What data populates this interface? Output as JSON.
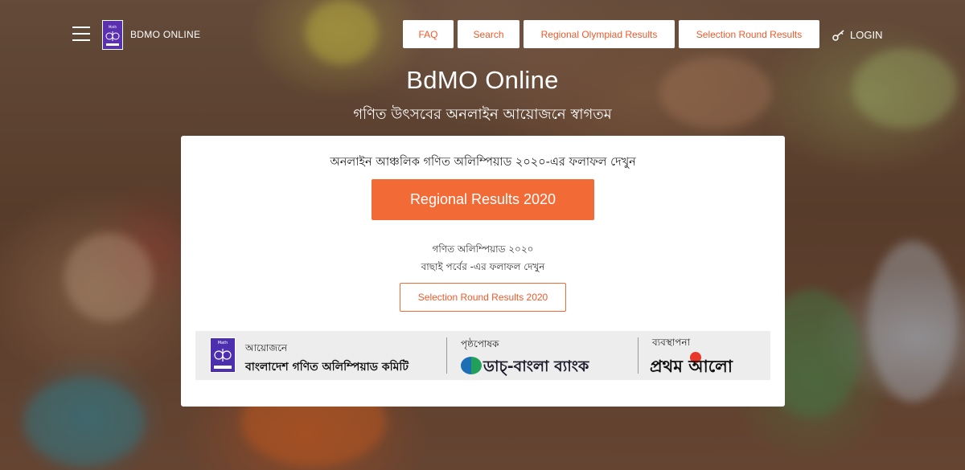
{
  "header": {
    "brand": "BDMO ONLINE",
    "nav": [
      "FAQ",
      "Search",
      "Regional Olympiad Results",
      "Selection Round Results"
    ],
    "login": "LOGIN"
  },
  "hero": {
    "title": "BdMO Online",
    "subtitle": "গণিত উৎসবের অনলাইন আয়োজনে স্বাগতম"
  },
  "card": {
    "heading": "অনলাইন আঞ্চলিক গণিত অলিম্পিয়াড ২০২০-এর ফলাফল দেখুন",
    "primary_button": "Regional Results 2020",
    "selection_line1": "গণিত অলিম্পিয়াড ২০২০",
    "selection_line2": "বাছাই পর্বের -এর ফলাফল দেখুন",
    "selection_button": "Selection Round Results 2020"
  },
  "sponsors": {
    "organizer_label": "আয়োজনে",
    "organizer_name": "বাংলাদেশ গণিত অলিম্পিয়াড কমিটি",
    "sponsor_label": "পৃষ্ঠপোষক",
    "sponsor_name": "ডাচ্-বাংলা ব্যাংক",
    "manager_label": "ব্যবস্থাপনা",
    "manager_name": "প্রথম আলো"
  },
  "colors": {
    "accent": "#f26a36",
    "nav_text": "#f0592a",
    "logo_purple": "#5a2fb0"
  }
}
